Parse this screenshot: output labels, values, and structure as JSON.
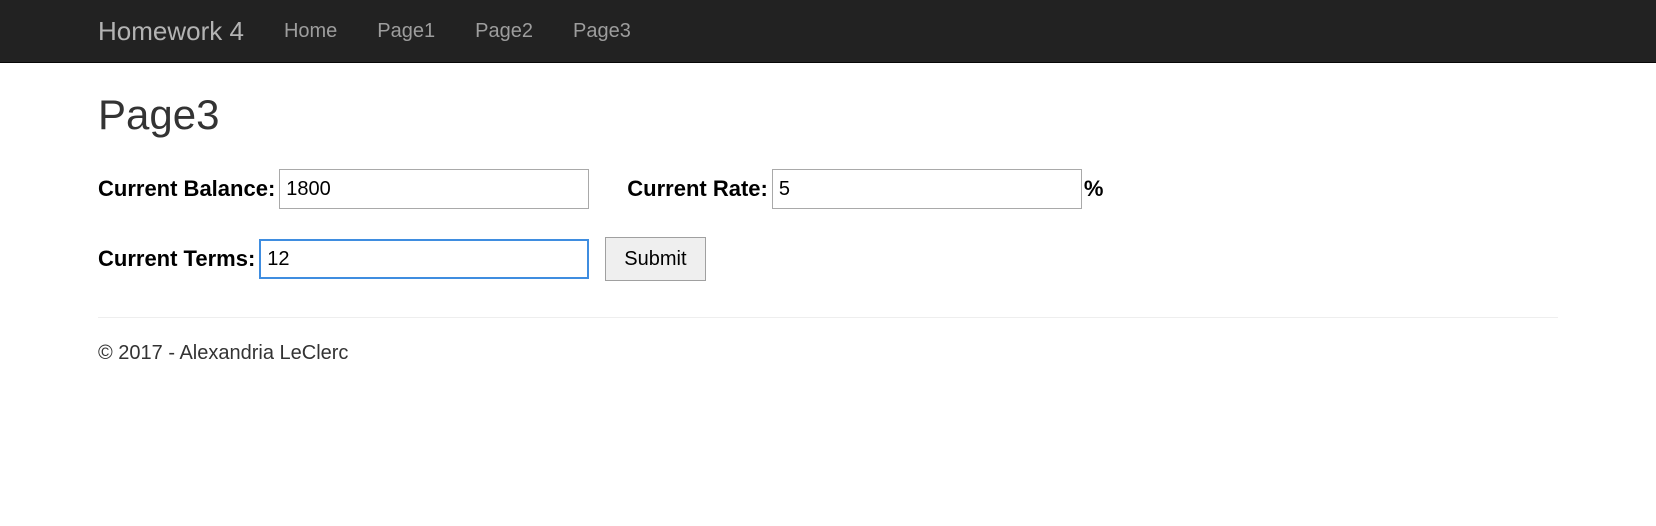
{
  "navbar": {
    "brand": "Homework 4",
    "links": {
      "home": "Home",
      "page1": "Page1",
      "page2": "Page2",
      "page3": "Page3"
    }
  },
  "page": {
    "title": "Page3"
  },
  "form": {
    "balance_label": "Current Balance:",
    "balance_value": "1800",
    "rate_label": "Current Rate:",
    "rate_value": "5",
    "rate_unit": "%",
    "terms_label": "Current Terms:",
    "terms_value": "12",
    "submit_label": "Submit"
  },
  "footer": {
    "text": "© 2017 - Alexandria LeClerc"
  }
}
